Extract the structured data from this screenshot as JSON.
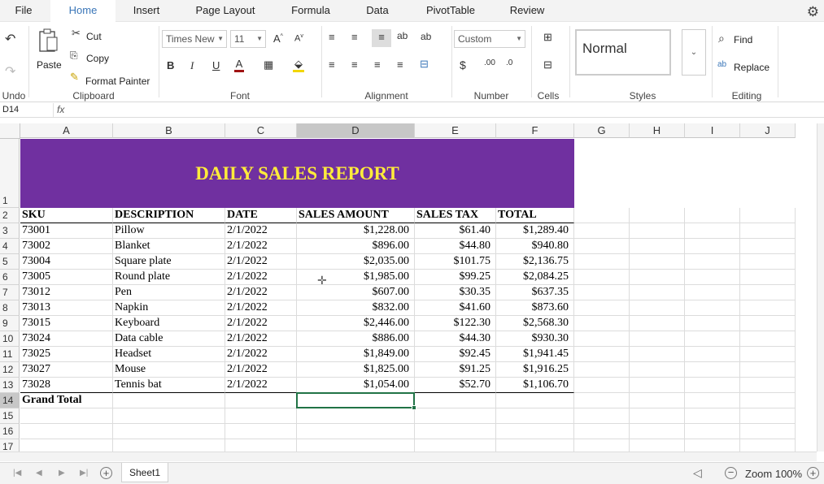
{
  "tabs": [
    "File",
    "Home",
    "Insert",
    "Page Layout",
    "Formula",
    "Data",
    "PivotTable",
    "Review"
  ],
  "ribbon": {
    "undo_label": "Undo",
    "clipboard_label": "Clipboard",
    "font_label": "Font",
    "alignment_label": "Alignment",
    "number_label": "Number",
    "cells_label": "Cells",
    "styles_label": "Styles",
    "editing_label": "Editing",
    "paste": "Paste",
    "cut": "Cut",
    "copy": "Copy",
    "format_painter": "Format Painter",
    "font_name": "Times New",
    "font_size": "11",
    "bold": "B",
    "italic": "I",
    "underline": "U",
    "number_format": "Custom",
    "currency": "$",
    "style_normal": "Normal",
    "find": "Find",
    "replace": "Replace"
  },
  "formula_bar": {
    "name_box": "D14",
    "fx": "fx",
    "value": ""
  },
  "columns": [
    "A",
    "B",
    "C",
    "D",
    "E",
    "F",
    "G",
    "H",
    "I",
    "J"
  ],
  "selected_column": "D",
  "row_numbers": [
    "1",
    "2",
    "3",
    "4",
    "5",
    "6",
    "7",
    "8",
    "9",
    "10",
    "11",
    "12",
    "13",
    "14",
    "15",
    "16",
    "17"
  ],
  "sheet": {
    "title": "DAILY SALES REPORT",
    "headers": [
      "SKU",
      "DESCRIPTION",
      "DATE",
      "SALES AMOUNT",
      "SALES TAX",
      "TOTAL"
    ],
    "rows": [
      [
        "73001",
        "Pillow",
        "2/1/2022",
        "$1,228.00",
        "$61.40",
        "$1,289.40"
      ],
      [
        "73002",
        "Blanket",
        "2/1/2022",
        "$896.00",
        "$44.80",
        "$940.80"
      ],
      [
        "73004",
        "Square plate",
        "2/1/2022",
        "$2,035.00",
        "$101.75",
        "$2,136.75"
      ],
      [
        "73005",
        "Round plate",
        "2/1/2022",
        "$1,985.00",
        "$99.25",
        "$2,084.25"
      ],
      [
        "73012",
        "Pen",
        "2/1/2022",
        "$607.00",
        "$30.35",
        "$637.35"
      ],
      [
        "73013",
        "Napkin",
        "2/1/2022",
        "$832.00",
        "$41.60",
        "$873.60"
      ],
      [
        "73015",
        "Keyboard",
        "2/1/2022",
        "$2,446.00",
        "$122.30",
        "$2,568.30"
      ],
      [
        "73024",
        "Data cable",
        "2/1/2022",
        "$886.00",
        "$44.30",
        "$930.30"
      ],
      [
        "73025",
        "Headset",
        "2/1/2022",
        "$1,849.00",
        "$92.45",
        "$1,941.45"
      ],
      [
        "73027",
        "Mouse",
        "2/1/2022",
        "$1,825.00",
        "$91.25",
        "$1,916.25"
      ],
      [
        "73028",
        "Tennis bat",
        "2/1/2022",
        "$1,054.00",
        "$52.70",
        "$1,106.70"
      ]
    ],
    "grand_total_label": "Grand Total"
  },
  "sheet_tabs": [
    "Sheet1"
  ],
  "zoom": "Zoom 100%",
  "colors": {
    "banner": "#7030a0",
    "title_text": "#ffeb3b",
    "accent": "#3a76b8",
    "selection": "#217346"
  }
}
